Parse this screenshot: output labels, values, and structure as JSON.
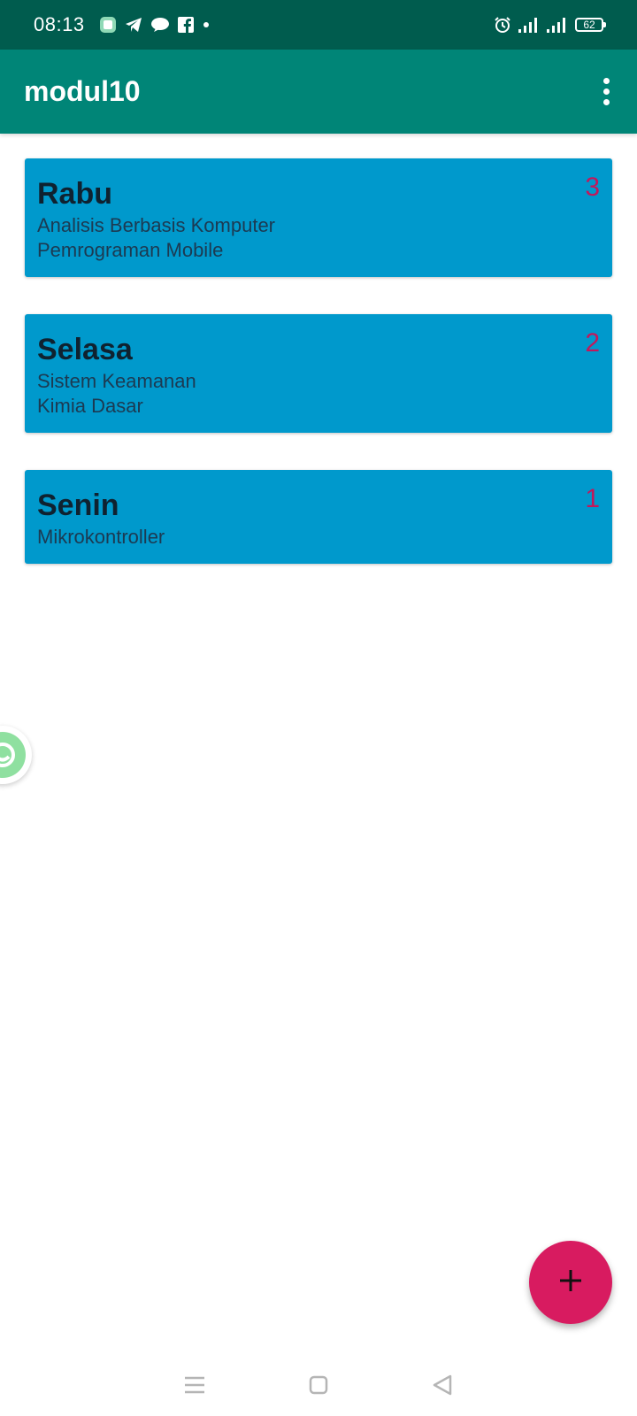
{
  "status_bar": {
    "time": "08:13",
    "battery_level": "62",
    "left_icons": [
      "app-icon",
      "telegram-icon",
      "talk-icon",
      "facebook-icon",
      "dot-icon"
    ],
    "right_icons": [
      "alarm-icon",
      "signal-icon",
      "signal-icon",
      "battery-icon"
    ]
  },
  "app_bar": {
    "title": "modul10",
    "menu_icon": "overflow-menu-icon"
  },
  "days": [
    {
      "name": "Rabu",
      "count": "3",
      "courses": [
        "Analisis Berbasis Komputer",
        "Pemrograman Mobile"
      ]
    },
    {
      "name": "Selasa",
      "count": "2",
      "courses": [
        "Sistem Keamanan",
        "Kimia Dasar"
      ]
    },
    {
      "name": "Senin",
      "count": "1",
      "courses": [
        "Mikrokontroller"
      ]
    }
  ],
  "fab": {
    "icon": "plus-icon"
  },
  "nav_bar": {
    "icons": [
      "menu-icon",
      "home-icon",
      "back-icon"
    ]
  },
  "colors": {
    "status_bar": "#005c4e",
    "app_bar": "#008577",
    "card": "#0099cc",
    "count": "#c2185b",
    "fab": "#d81b60"
  }
}
